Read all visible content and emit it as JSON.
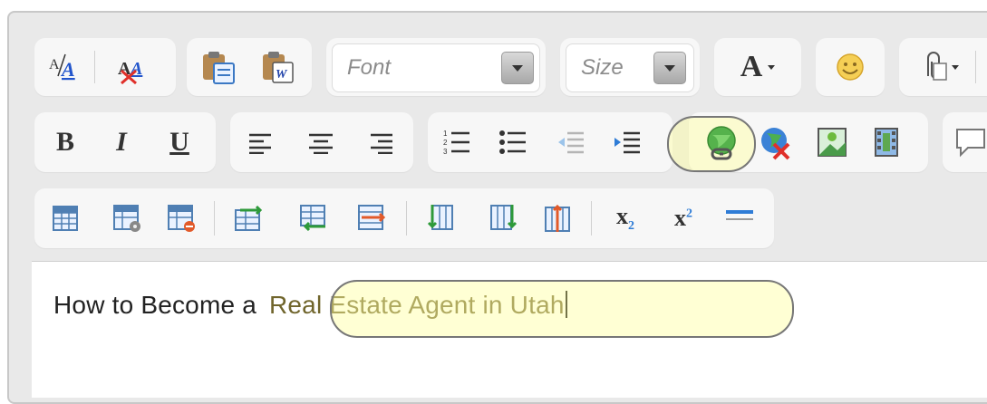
{
  "toolbar": {
    "font_combo": {
      "label": "Font"
    },
    "size_combo": {
      "label": "Size"
    },
    "text_color": {
      "glyph": "A"
    },
    "bold_glyph": "B",
    "italic_glyph": "I",
    "underline_glyph": "U",
    "subscript": {
      "base": "x",
      "sub": "2"
    },
    "superscript": {
      "base": "x",
      "sup": "2"
    },
    "format_icons": {
      "style_a": "A",
      "style_b": "A"
    }
  },
  "editor": {
    "text_before": "How to Become a",
    "highlighted_text": "Real Estate Agent in Utah"
  },
  "colors": {
    "toolbar_bg": "#e9e9e9",
    "group_bg": "#f7f7f7",
    "callout_fill": "#ffffa0",
    "highlight_text": "#70652c"
  }
}
